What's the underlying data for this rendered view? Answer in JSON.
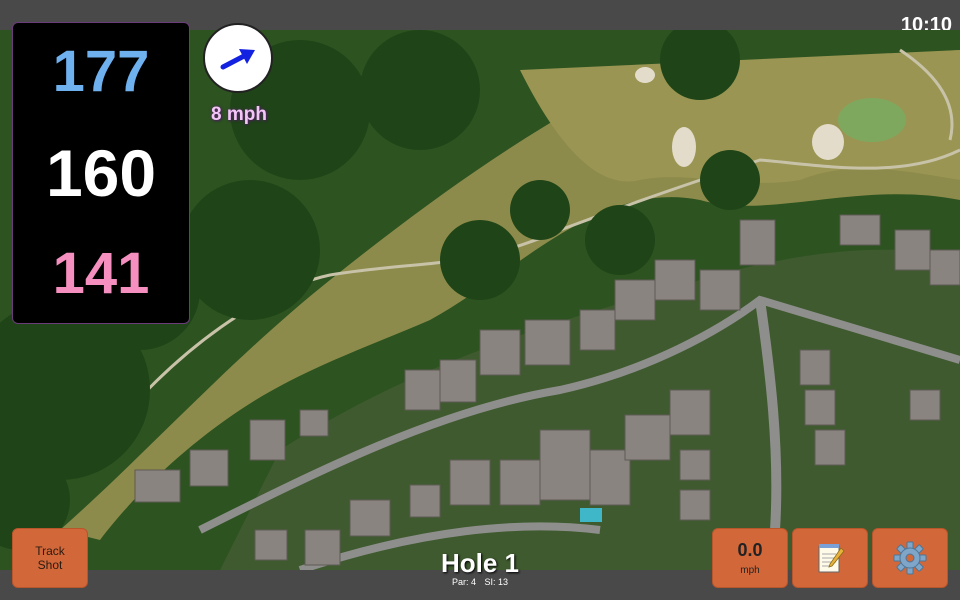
{
  "status": {
    "time": "10:10"
  },
  "distances": {
    "back": "177",
    "middle": "160",
    "front": "141"
  },
  "wind": {
    "speed_label": "8 mph",
    "direction_icon": "arrow-right-icon"
  },
  "hole": {
    "title": "Hole 1",
    "par": "Par: 4",
    "stroke_index": "SI: 13"
  },
  "buttons": {
    "track_shot_line1": "Track",
    "track_shot_line2": "Shot",
    "speed_value": "0.0",
    "speed_unit": "mph",
    "notes_icon": "notepad-icon",
    "settings_icon": "gear-icon"
  },
  "colors": {
    "back_distance": "#6fb0ef",
    "middle_distance": "#ffffff",
    "front_distance": "#f58fbf",
    "button": "#d2683a",
    "wind_label": "#f4c6f8"
  }
}
